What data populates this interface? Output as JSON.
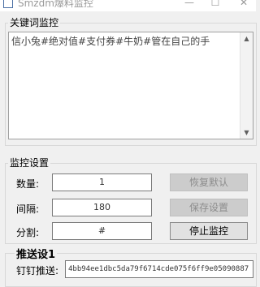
{
  "window": {
    "title": "Smzdm爆料监控",
    "minimize": "—",
    "maximize": "☐",
    "close": "✕"
  },
  "keywords": {
    "legend": "关键词监控",
    "text": "信小兔#绝对值#支付券#牛奶#管在自己的手",
    "scroll_up": "▲",
    "scroll_down": "▼"
  },
  "settings": {
    "legend": "监控设置",
    "count_label": "数量:",
    "count_value": "1",
    "interval_label": "间隔:",
    "interval_value": "180",
    "split_label": "分割:",
    "split_value": "#",
    "restore_button": "恢复默认",
    "save_button": "保存设置",
    "stop_button": "停止监控"
  },
  "push": {
    "legend": "推送设1",
    "dingtalk_label": "钉钉推送:",
    "dingtalk_value": "4bb94ee1dbc5da79f6714cde075f6ff9e05090887"
  }
}
